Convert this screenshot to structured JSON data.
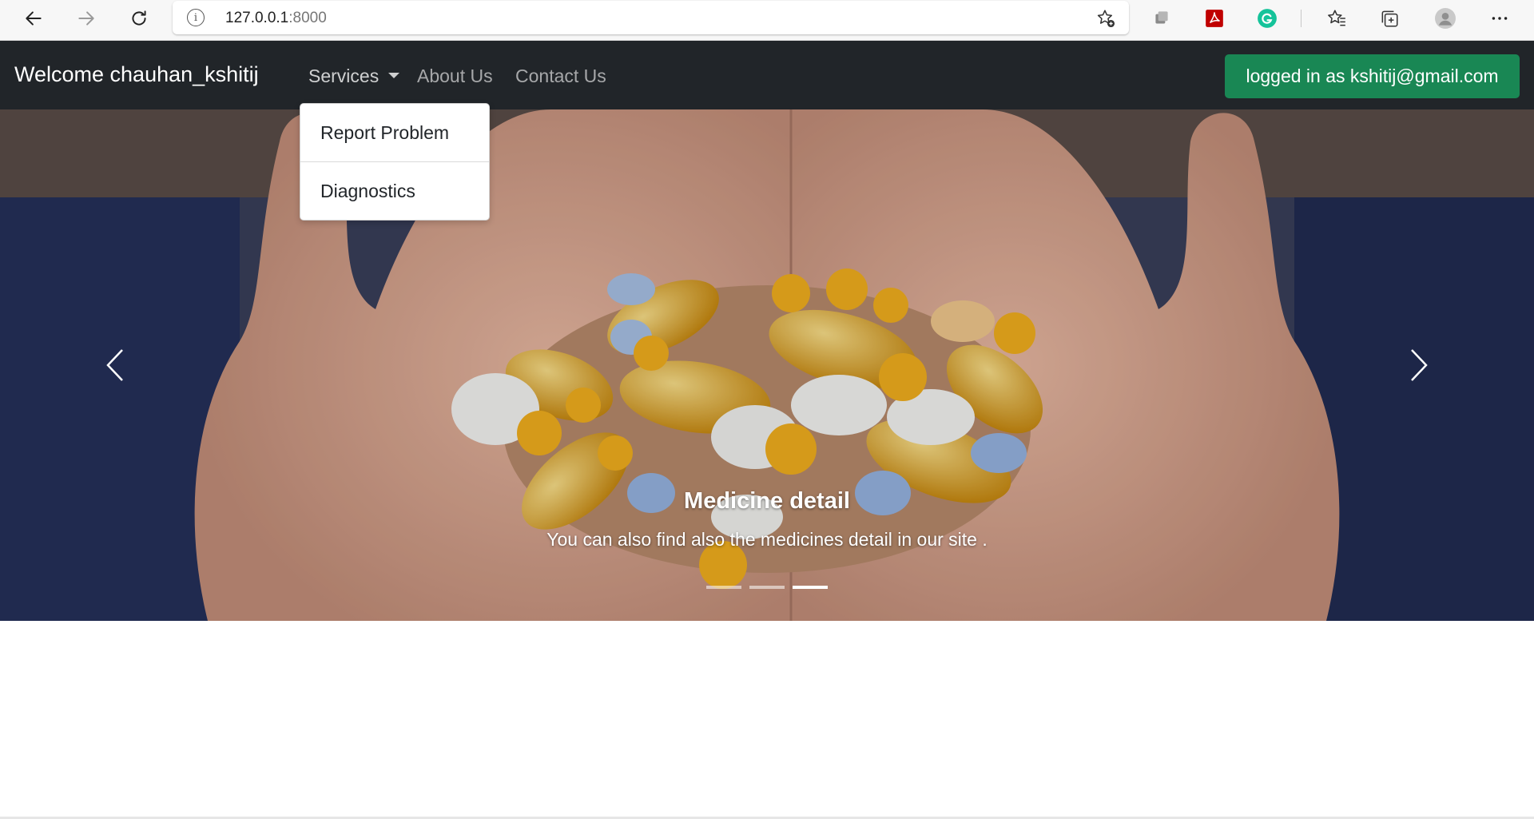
{
  "browser": {
    "url_host": "127.0.0.1",
    "url_port": ":8000",
    "icons": [
      "back-arrow-icon",
      "forward-arrow-icon",
      "refresh-icon",
      "info-icon",
      "add-favorite-icon",
      "extension-puzzle-icon",
      "pdf-icon",
      "grammarly-icon",
      "favorites-icon",
      "collections-icon",
      "profile-icon",
      "more-icon"
    ]
  },
  "navbar": {
    "brand": "Welcome chauhan_kshitij",
    "services_label": "Services",
    "about_label": "About Us",
    "contact_label": "Contact Us",
    "login_badge": "logged in as kshitij@gmail.com"
  },
  "dropdown": {
    "items": [
      {
        "label": "Report Problem"
      },
      {
        "label": "Diagnostics"
      }
    ]
  },
  "carousel": {
    "caption_title": "Medicine detail",
    "caption_text": "You can also find also the medicines detail in our site .",
    "slide_count": 3,
    "active_slide": 3
  },
  "colors": {
    "navbar_bg": "#212529",
    "login_badge_bg": "#198754",
    "pdf_red": "#c00000",
    "grammarly_green": "#15c39a"
  }
}
